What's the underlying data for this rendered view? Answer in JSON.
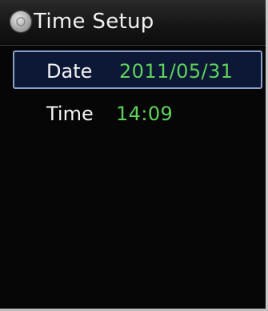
{
  "header": {
    "title": "Time Setup",
    "icon": "settings-icon"
  },
  "menu": {
    "items": [
      {
        "label": "Date",
        "value": "2011/05/31",
        "selected": true
      },
      {
        "label": "Time",
        "value": "14:09",
        "selected": false
      }
    ]
  },
  "colors": {
    "background": "#060606",
    "label_text": "#f4f4f4",
    "value_text": "#5fd35a",
    "selection_border": "#8aa0c8",
    "selection_fill": "#0d1736"
  }
}
